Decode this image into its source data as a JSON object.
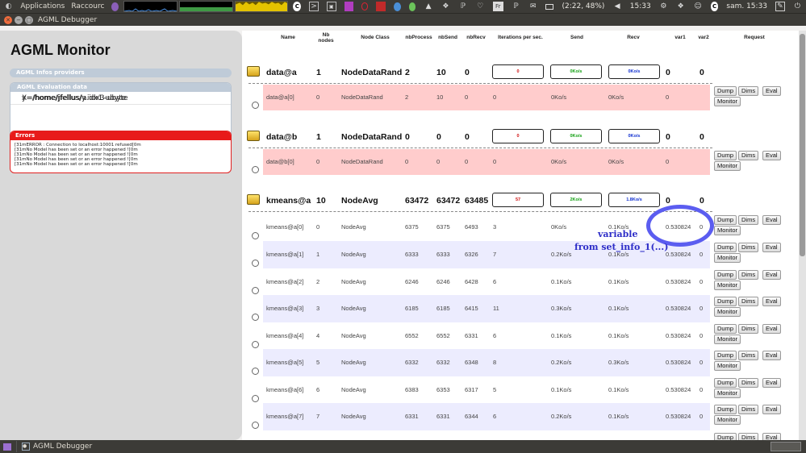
{
  "top_panel": {
    "applications": "Applications",
    "raccourcis": "Raccourc",
    "keyboard": "Fr",
    "battery": "(2:22, 48%)",
    "time": "15:33",
    "datetime": "sam. 15:33"
  },
  "window": {
    "title": "AGML Debugger"
  },
  "left": {
    "title": "AGML Monitor",
    "infos_header": "AGML Infos providers",
    "eval_header": "AGML Evaluation data",
    "eval_rows": [
      "X=/home/jfellus/a.idx3-ubyte",
      "y=/home/jfellus/y.idx1-ubyte"
    ],
    "errors_header": "Errors",
    "error_lines": [
      "[31mERROR : Connection to localhost:10001 refused[0m",
      "[31mNo Model has been set or an error happened ![0m",
      "[31mNo Model has been set or an error happened ![0m",
      "[31mNo Model has been set or an error happened ![0m",
      "[31mNo Model has been set or an error happened ![0m"
    ]
  },
  "table": {
    "headers": {
      "name": "Name",
      "nb_nodes": "Nb nodes",
      "node_class": "Node Class",
      "nb_process": "nbProcess",
      "nb_send": "nbSend",
      "nb_recv": "nbRecv",
      "iterations": "Iterations per sec.",
      "send": "Send",
      "recv": "Recv",
      "var1": "var1",
      "var2": "var2",
      "request": "Request"
    },
    "buttons": {
      "dump": "Dump",
      "dims": "Dims",
      "eval": "Eval",
      "monitor": "Monitor"
    },
    "groups": [
      {
        "name": "data@a",
        "nodes": "1",
        "cls": "NodeDataRand",
        "proc": "2",
        "send": "10",
        "recv": "0",
        "ips": "0",
        "send_rate": "0Ko/s",
        "recv_rate": "0Ko/s",
        "var1": "0",
        "var2": "0"
      },
      {
        "name": "data@b",
        "nodes": "1",
        "cls": "NodeDataRand",
        "proc": "0",
        "send": "0",
        "recv": "0",
        "ips": "0",
        "send_rate": "0Ko/s",
        "recv_rate": "0Ko/s",
        "var1": "0",
        "var2": "0"
      },
      {
        "name": "kmeans@a",
        "nodes": "10",
        "cls": "NodeAvg",
        "proc": "63472",
        "send": "63472",
        "recv": "63485",
        "ips": "57",
        "send_rate": "2Ko/s",
        "recv_rate": "1.8Ko/s",
        "var1": "0",
        "var2": "0"
      }
    ],
    "subrows": [
      {
        "name": "data@a[0]",
        "id": "0",
        "cls": "NodeDataRand",
        "proc": "2",
        "send": "10",
        "recv": "0",
        "ips": "0",
        "send_rate": "0Ko/s",
        "recv_rate": "0Ko/s",
        "var1": "0",
        "var2": ""
      },
      {
        "name": "data@b[0]",
        "id": "0",
        "cls": "NodeDataRand",
        "proc": "0",
        "send": "0",
        "recv": "0",
        "ips": "0",
        "send_rate": "0Ko/s",
        "recv_rate": "0Ko/s",
        "var1": "0",
        "var2": ""
      },
      {
        "name": "kmeans@a[0]",
        "id": "0",
        "cls": "NodeAvg",
        "proc": "6375",
        "send": "6375",
        "recv": "6493",
        "ips": "3",
        "send_rate": "0Ko/s",
        "recv_rate": "0.1Ko/s",
        "var1": "0.530824",
        "var2": "0"
      },
      {
        "name": "kmeans@a[1]",
        "id": "1",
        "cls": "NodeAvg",
        "proc": "6333",
        "send": "6333",
        "recv": "6326",
        "ips": "7",
        "send_rate": "0.2Ko/s",
        "recv_rate": "0.1Ko/s",
        "var1": "0.530824",
        "var2": "0"
      },
      {
        "name": "kmeans@a[2]",
        "id": "2",
        "cls": "NodeAvg",
        "proc": "6246",
        "send": "6246",
        "recv": "6428",
        "ips": "6",
        "send_rate": "0.1Ko/s",
        "recv_rate": "0.1Ko/s",
        "var1": "0.530824",
        "var2": "0"
      },
      {
        "name": "kmeans@a[3]",
        "id": "3",
        "cls": "NodeAvg",
        "proc": "6185",
        "send": "6185",
        "recv": "6415",
        "ips": "11",
        "send_rate": "0.3Ko/s",
        "recv_rate": "0.1Ko/s",
        "var1": "0.530824",
        "var2": "0"
      },
      {
        "name": "kmeans@a[4]",
        "id": "4",
        "cls": "NodeAvg",
        "proc": "6552",
        "send": "6552",
        "recv": "6331",
        "ips": "6",
        "send_rate": "0.1Ko/s",
        "recv_rate": "0.1Ko/s",
        "var1": "0.530824",
        "var2": "0"
      },
      {
        "name": "kmeans@a[5]",
        "id": "5",
        "cls": "NodeAvg",
        "proc": "6332",
        "send": "6332",
        "recv": "6348",
        "ips": "8",
        "send_rate": "0.2Ko/s",
        "recv_rate": "0.3Ko/s",
        "var1": "0.530824",
        "var2": "0"
      },
      {
        "name": "kmeans@a[6]",
        "id": "6",
        "cls": "NodeAvg",
        "proc": "6383",
        "send": "6353",
        "recv": "6317",
        "ips": "5",
        "send_rate": "0.1Ko/s",
        "recv_rate": "0.1Ko/s",
        "var1": "0.530824",
        "var2": "0"
      },
      {
        "name": "kmeans@a[7]",
        "id": "7",
        "cls": "NodeAvg",
        "proc": "6331",
        "send": "6331",
        "recv": "6344",
        "ips": "6",
        "send_rate": "0.2Ko/s",
        "recv_rate": "0.1Ko/s",
        "var1": "0.530824",
        "var2": "0"
      }
    ]
  },
  "annotation": {
    "line1": "variable",
    "line2": "from set_info_1(...)"
  },
  "taskbar": {
    "item": "AGML Debugger"
  }
}
